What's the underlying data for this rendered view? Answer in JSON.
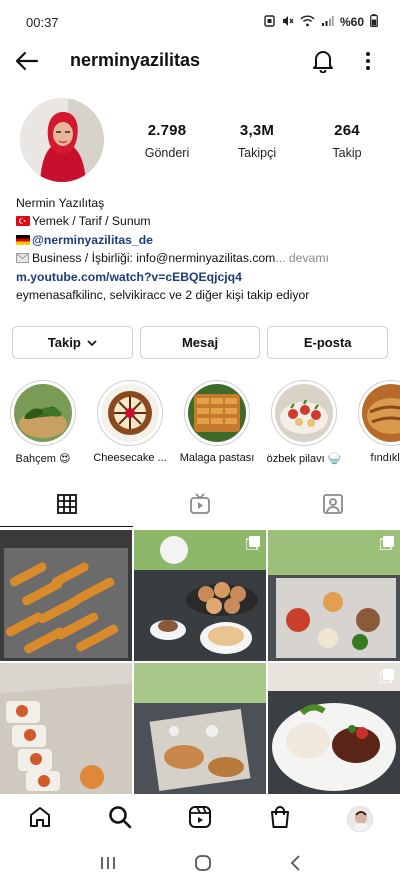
{
  "status_bar": {
    "time": "00:37",
    "battery": "%60"
  },
  "profile": {
    "username": "nerminyazilitas",
    "stats": [
      {
        "value": "2.798",
        "label": "Gönderi"
      },
      {
        "value": "3,3M",
        "label": "Takipçi"
      },
      {
        "value": "264",
        "label": "Takip"
      }
    ],
    "bio": {
      "name": "Nermin Yazılıtaş",
      "line1": "Yemek / Tarif / Sunum",
      "line2": "@nerminyazilitas_de",
      "line3": "Business / İşbirliği: info@nerminyazilitas.com",
      "line3_more": "... devamı",
      "line4": "m.youtube.com/watch?v=cEBQEqjcjq4",
      "line5": "eymenasafkilinc, selvikiracc ve 2 diğer kişi takip ediyor"
    }
  },
  "actions": {
    "follow": "Takip",
    "message": "Mesaj",
    "email": "E-posta"
  },
  "highlights": [
    {
      "label": "Bahçem 😍"
    },
    {
      "label": "Cheesecake ..."
    },
    {
      "label": "Malaga pastası"
    },
    {
      "label": "özbek pilavı 🍚"
    },
    {
      "label": "fındıklı ç"
    }
  ],
  "icons": {
    "back": "back-arrow-icon",
    "bell": "bell-icon",
    "more": "more-vertical-icon",
    "grid": "grid-icon",
    "igtv": "igtv-icon",
    "tagged": "tagged-icon",
    "home": "home-icon",
    "search": "search-icon",
    "reels": "reels-icon",
    "shop": "shop-icon"
  },
  "colors": {
    "link": "#1c3d7a",
    "muted": "#8a8a8a",
    "avatar_bg": "#c8102e"
  }
}
